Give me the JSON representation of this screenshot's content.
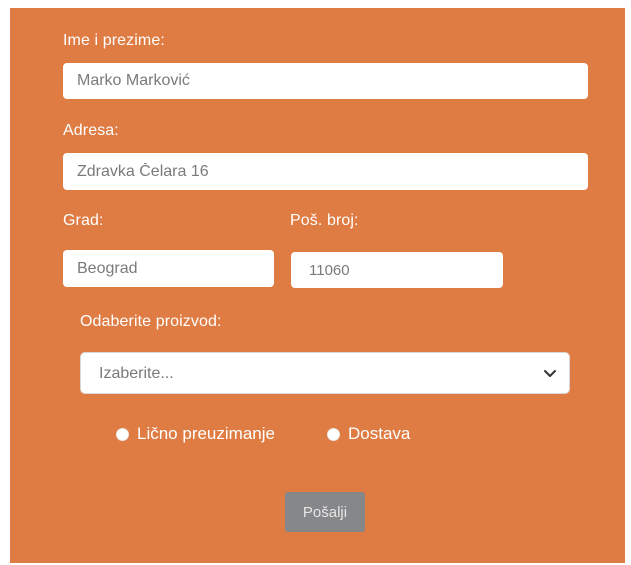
{
  "form": {
    "name_label": "Ime i prezime:",
    "name_value": "Marko Marković",
    "address_label": "Adresa:",
    "address_value": "Zdravka Čelara 16",
    "city_label": "Grad:",
    "city_value": "Beograd",
    "zip_label": "Poš. broj:",
    "zip_value": "11060",
    "product_label": "Odaberite proizvod:",
    "product_selected": "Izaberite...",
    "delivery_options": [
      {
        "label": "Lično preuzimanje"
      },
      {
        "label": "Dostava"
      }
    ],
    "submit_label": "Pošalji"
  },
  "colors": {
    "panel_background": "#df7c43",
    "submit_background": "#868789"
  },
  "icons": {
    "select_arrow": "chevron-down-icon"
  }
}
